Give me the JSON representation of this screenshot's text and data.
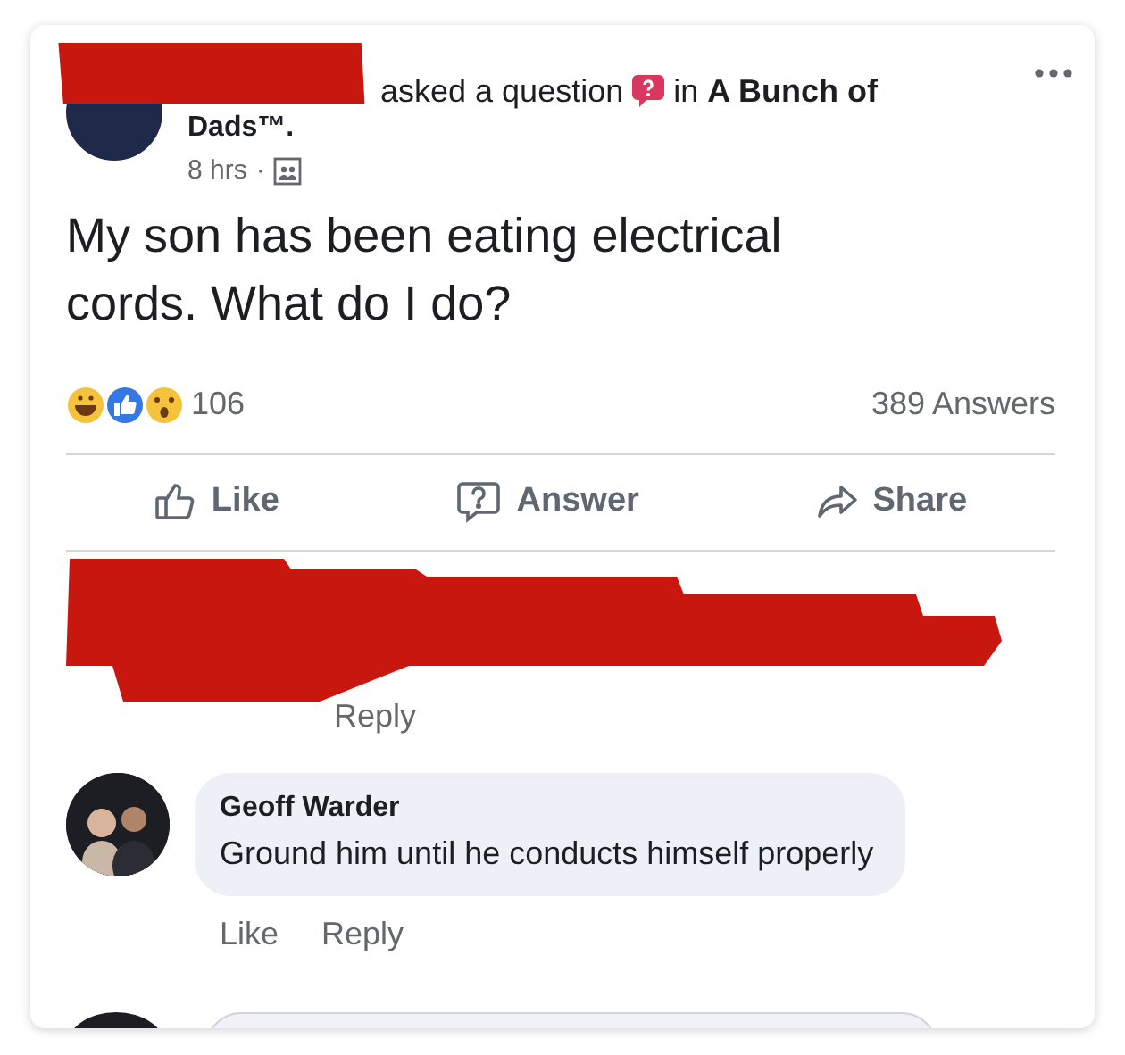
{
  "post": {
    "action": "asked a question",
    "group_line": "in **A Bunch of**",
    "group_end": "Dads™.",
    "time": "8 hrs",
    "dot": "·",
    "question": "My son has been eating electrical cords. What do I do?",
    "reaction_count": "106",
    "answer_count": "389 Answers"
  },
  "actions": [
    {
      "kind": "like",
      "label": "Like"
    },
    {
      "kind": "answer",
      "label": "Answer"
    },
    {
      "kind": "share",
      "label": "Share"
    }
  ],
  "comments": [
    {
      "kind": "redacted",
      "actions": [
        "Reply"
      ]
    },
    {
      "kind": "comment",
      "author": "Geoff Warder",
      "text": "Ground him until he conducts himself properly",
      "actions": [
        "Like",
        "Reply"
      ]
    }
  ]
}
